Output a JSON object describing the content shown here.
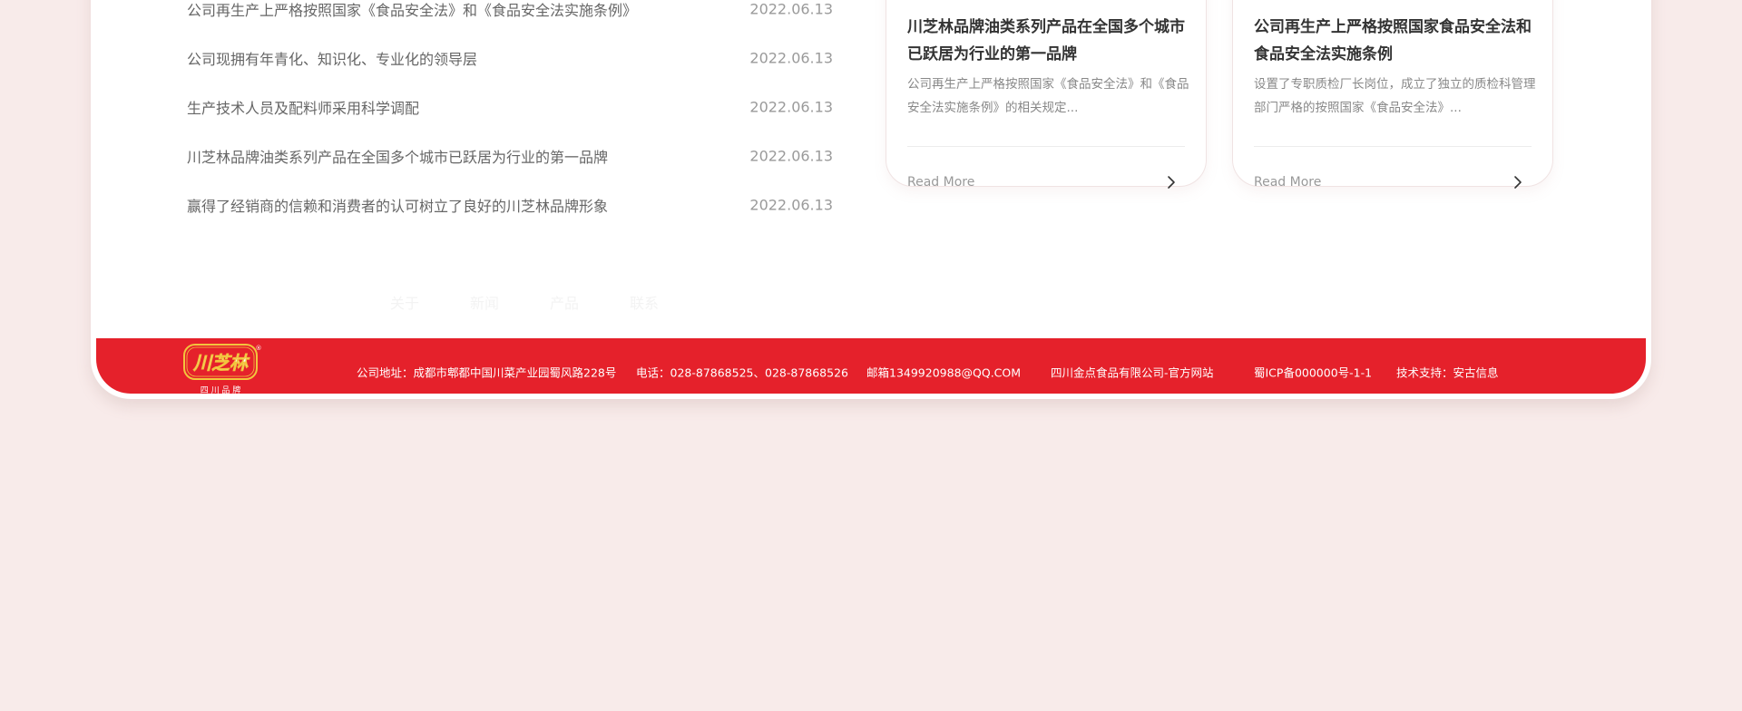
{
  "news": [
    {
      "title": "公司再生产上严格按照国家《食品安全法》和《食品安全法实施条例》",
      "date": "2022.06.13"
    },
    {
      "title": "公司现拥有年青化、知识化、专业化的领导层",
      "date": "2022.06.13"
    },
    {
      "title": "生产技术人员及配料师采用科学调配",
      "date": "2022.06.13"
    },
    {
      "title": "川芝林品牌油类系列产品在全国多个城市已跃居为行业的第一品牌",
      "date": "2022.06.13"
    },
    {
      "title": "赢得了经销商的信赖和消费者的认可树立了良好的川芝林品牌形象",
      "date": "2022.06.13"
    }
  ],
  "cards": [
    {
      "title": "川芝林品牌油类系列产品在全国多个城市已跃居为行业的第一品牌",
      "desc": "公司再生产上严格按照国家《食品安全法》和《食品安全法实施条例》的相关规定...",
      "read_more": "Read More",
      "icon": "chevron-right-icon"
    },
    {
      "title": "公司再生产上严格按照国家食品安全法和食品安全法实施条例",
      "desc": "设置了专职质检厂长岗位，成立了独立的质检科管理部门严格的按照国家《食品安全法》...",
      "read_more": "Read More",
      "icon": "chevron-right-icon"
    }
  ],
  "ghost_nav": [
    "关于",
    "新闻",
    "产品",
    "联系"
  ],
  "footer": {
    "logo": {
      "brand": "川芝林",
      "sub": "四 川 品 牌",
      "mark": "®"
    },
    "address": "公司地址：成都市郫都中国川菜产业园蜀风路228号",
    "phone": "电话：028-87868525、028-87868526",
    "email": "邮箱1349920988@QQ.COM",
    "company": "四川金点食品有限公司-官方网站",
    "icp": "蜀ICP备000000号-1-1",
    "support": "技术支持：安古信息"
  },
  "colors": {
    "page_bg": "#f8ebea",
    "footer_red": "#e5212b",
    "logo_gold": "#f2c43d"
  }
}
